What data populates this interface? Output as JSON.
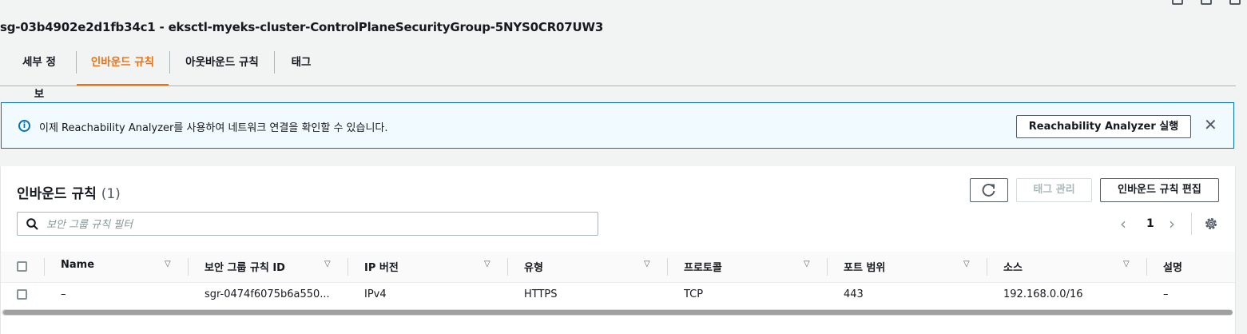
{
  "page": {
    "title": "sg-03b4902e2d1fb34c1 - eksctl-myeks-cluster-ControlPlaneSecurityGroup-5NYS0CR07UW3"
  },
  "tabs": [
    {
      "label": "세부 정보",
      "active": false
    },
    {
      "label": "인바운드 규칙",
      "active": true
    },
    {
      "label": "아웃바운드 규칙",
      "active": false
    },
    {
      "label": "태그",
      "active": false
    }
  ],
  "alert": {
    "text": "이제 Reachability Analyzer를 사용하여 네트워크 연결을 확인할 수 있습니다.",
    "button_label": "Reachability Analyzer 실행",
    "close_glyph": "✕",
    "info_glyph": "i"
  },
  "panel": {
    "title": "인바운드 규칙",
    "count": "(1)",
    "tag_manage_label": "태그 관리",
    "edit_label": "인바운드 규칙 편집",
    "filter_placeholder": "보안 그룹 규칙 필터",
    "pagination": {
      "prev": "‹",
      "current": "1",
      "next": "›"
    }
  },
  "table": {
    "columns": [
      "Name",
      "보안 그룹 규칙 ID",
      "IP 버전",
      "유형",
      "프로토콜",
      "포트 범위",
      "소스",
      "설명"
    ],
    "rows": [
      {
        "name": "–",
        "rule_id": "sgr-0474f6075b6a550...",
        "ip_version": "IPv4",
        "type": "HTTPS",
        "protocol": "TCP",
        "port_range": "443",
        "source": "192.168.0.0/16",
        "description": "–"
      }
    ]
  },
  "colors": {
    "accent": "#ec7211",
    "info": "#0073bb",
    "alert_bg": "#f1faff"
  }
}
